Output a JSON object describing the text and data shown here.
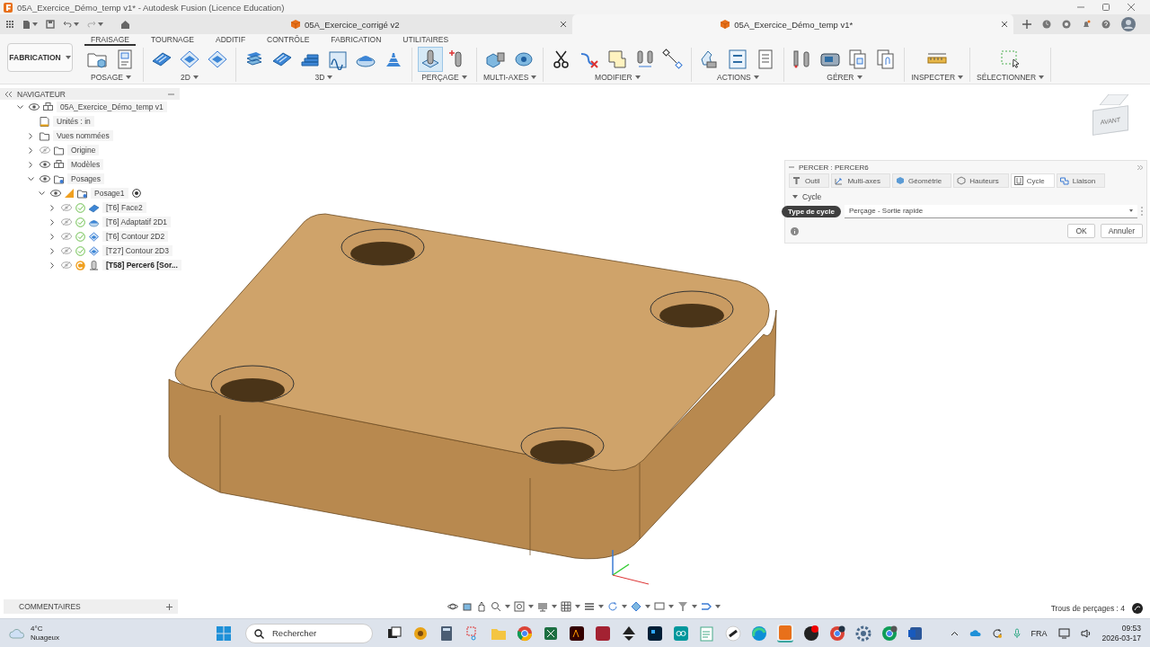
{
  "window": {
    "title": "05A_Exercice_Démo_temp v1* - Autodesk Fusion (Licence Education)"
  },
  "doc_tabs": [
    {
      "label": "05A_Exercice_corrigé v2",
      "selected": false
    },
    {
      "label": "05A_Exercice_Démo_temp v1*",
      "selected": true
    }
  ],
  "workspace": {
    "label": "FABRICATION"
  },
  "ribbon_tabs": [
    {
      "label": "FRAISAGE",
      "selected": true
    },
    {
      "label": "TOURNAGE",
      "selected": false
    },
    {
      "label": "ADDITIF",
      "selected": false
    },
    {
      "label": "CONTRÔLE",
      "selected": false
    },
    {
      "label": "FABRICATION",
      "selected": false
    },
    {
      "label": "UTILITAIRES",
      "selected": false
    }
  ],
  "ribbon_groups": [
    {
      "label": "POSAGE",
      "active": false
    },
    {
      "label": "2D",
      "active": false
    },
    {
      "label": "3D",
      "active": false
    },
    {
      "label": "PERÇAGE",
      "active": true
    },
    {
      "label": "MULTI-AXES",
      "active": false
    },
    {
      "label": "MODIFIER",
      "active": false
    },
    {
      "label": "ACTIONS",
      "active": false
    },
    {
      "label": "GÉRER",
      "active": false
    },
    {
      "label": "INSPECTER",
      "active": false
    },
    {
      "label": "SÉLECTIONNER",
      "active": false
    }
  ],
  "navigator": {
    "title": "NAVIGATEUR",
    "items": [
      {
        "label": "05A_Exercice_Démo_temp v1",
        "kind": "component",
        "expanded": true,
        "visible": true,
        "children": [
          {
            "label": "Unités : in",
            "kind": "units"
          },
          {
            "label": "Vues nommées",
            "kind": "folder",
            "expanded": false
          },
          {
            "label": "Origine",
            "kind": "folder",
            "expanded": false,
            "visible": false
          },
          {
            "label": "Modèles",
            "kind": "component",
            "expanded": false,
            "visible": true
          },
          {
            "label": "Posages",
            "kind": "setups",
            "expanded": true,
            "visible": true,
            "children": [
              {
                "label": "Posage1",
                "kind": "setup",
                "expanded": true,
                "visible": true,
                "children": [
                  {
                    "label": "[T6] Face2",
                    "kind": "face",
                    "expanded": false,
                    "visible": false,
                    "completed": true,
                    "active": false
                  },
                  {
                    "label": "[T6] Adaptatif 2D1",
                    "kind": "adaptive",
                    "expanded": false,
                    "visible": false,
                    "completed": true,
                    "active": false
                  },
                  {
                    "label": "[T6] Contour 2D2",
                    "kind": "contour",
                    "expanded": false,
                    "visible": false,
                    "completed": true,
                    "active": false
                  },
                  {
                    "label": "[T27] Contour 2D3",
                    "kind": "contour",
                    "expanded": false,
                    "visible": false,
                    "completed": true,
                    "active": false
                  },
                  {
                    "label": "[T58] Percer6 [Sor...",
                    "kind": "drill",
                    "expanded": false,
                    "visible": false,
                    "completed": false,
                    "active": true
                  }
                ]
              }
            ]
          }
        ]
      }
    ]
  },
  "dialog": {
    "title": "PERCER : PERCER6",
    "tabs": [
      {
        "label": "Outil",
        "selected": false
      },
      {
        "label": "Multi-axes",
        "selected": false
      },
      {
        "label": "Géométrie",
        "selected": false
      },
      {
        "label": "Hauteurs",
        "selected": false
      },
      {
        "label": "Cycle",
        "selected": true
      },
      {
        "label": "Liaison",
        "selected": false
      }
    ],
    "section": {
      "label": "Cycle",
      "expanded": true
    },
    "field": {
      "label": "Type de cycle",
      "value": "Perçage - Sortie rapide"
    },
    "buttons": [
      "OK",
      "Annuler"
    ]
  },
  "viewcube": {
    "label": "AVANT"
  },
  "comments": {
    "title": "COMMENTAIRES"
  },
  "status_bar": {
    "text": "Trous de perçages : 4"
  },
  "taskbar": {
    "temperature": "4°C",
    "condition": "Nuageux",
    "search": {
      "placeholder": "Rechercher"
    },
    "language": "FRA",
    "time": "09:53",
    "date": "2026-03-17"
  }
}
